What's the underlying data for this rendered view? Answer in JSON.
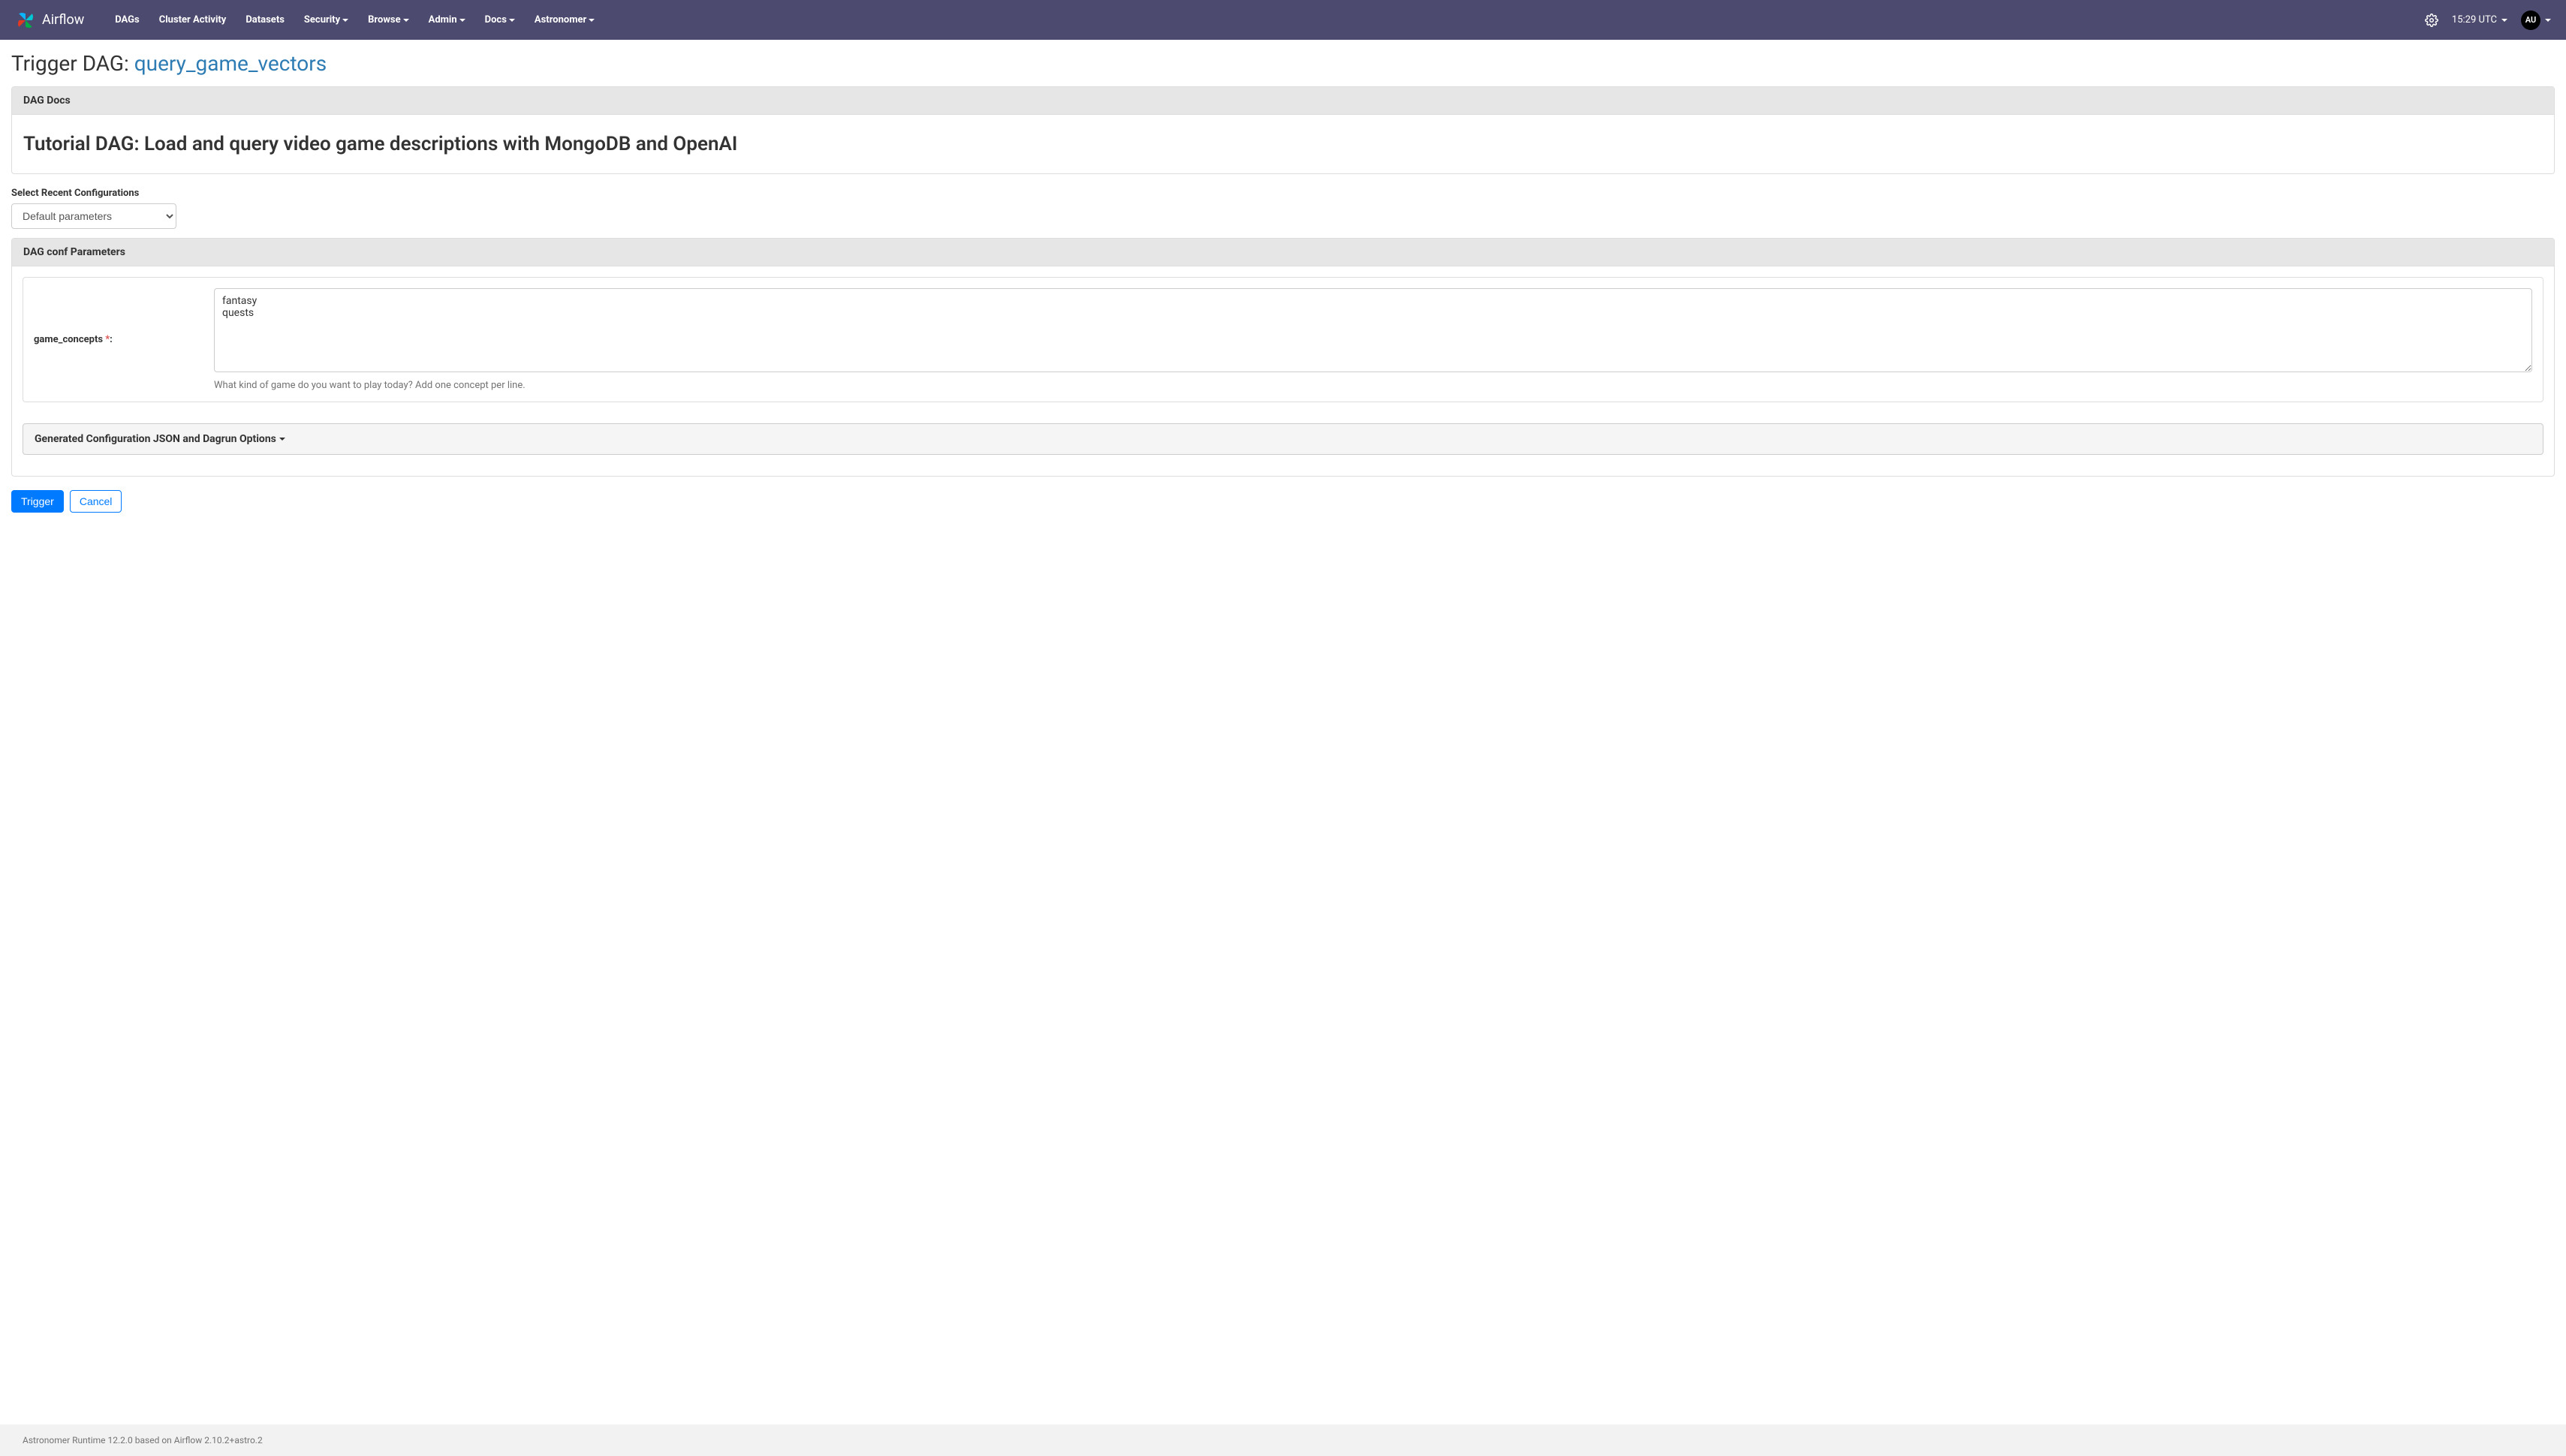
{
  "brand": {
    "text": "Airflow"
  },
  "nav": {
    "items": [
      {
        "label": "DAGs",
        "dropdown": false
      },
      {
        "label": "Cluster Activity",
        "dropdown": false
      },
      {
        "label": "Datasets",
        "dropdown": false
      },
      {
        "label": "Security",
        "dropdown": true
      },
      {
        "label": "Browse",
        "dropdown": true
      },
      {
        "label": "Admin",
        "dropdown": true
      },
      {
        "label": "Docs",
        "dropdown": true
      },
      {
        "label": "Astronomer",
        "dropdown": true
      }
    ],
    "clock": "15:29 UTC",
    "user": "AU"
  },
  "page": {
    "title_prefix": "Trigger DAG: ",
    "dag_id": "query_game_vectors"
  },
  "dag_docs": {
    "heading": "DAG Docs",
    "body": "Tutorial DAG: Load and query video game descriptions with MongoDB and OpenAI"
  },
  "recent": {
    "label": "Select Recent Configurations",
    "selected": "Default parameters"
  },
  "params_panel": {
    "heading": "DAG conf Parameters",
    "field": {
      "label": "game_concepts",
      "required_marker": "*",
      "colon": ":",
      "value": "fantasy\nquests",
      "help": "What kind of game do you want to play today? Add one concept per line."
    },
    "collapsible_heading": "Generated Configuration JSON and Dagrun Options"
  },
  "actions": {
    "trigger": "Trigger",
    "cancel": "Cancel"
  },
  "footer": {
    "text": "Astronomer Runtime 12.2.0 based on Airflow 2.10.2+astro.2"
  }
}
